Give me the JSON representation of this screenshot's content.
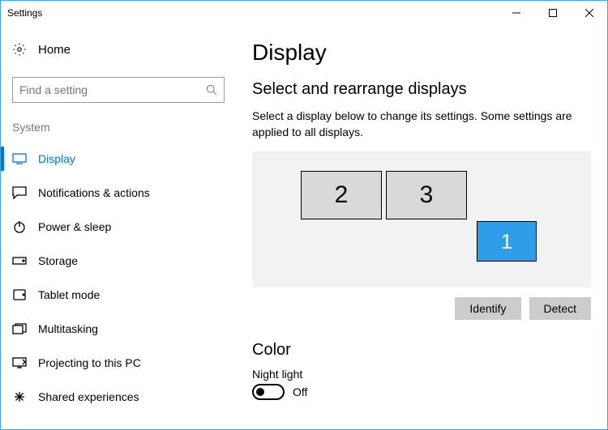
{
  "window": {
    "title": "Settings"
  },
  "home": {
    "label": "Home"
  },
  "search": {
    "placeholder": "Find a setting"
  },
  "section": "System",
  "nav": {
    "display": "Display",
    "notifications": "Notifications & actions",
    "power": "Power & sleep",
    "storage": "Storage",
    "tablet": "Tablet mode",
    "multitasking": "Multitasking",
    "projecting": "Projecting to this PC",
    "shared": "Shared experiences"
  },
  "page": {
    "title": "Display",
    "arrange_heading": "Select and rearrange displays",
    "arrange_desc": "Select a display below to change its settings. Some settings are applied to all displays.",
    "monitors": {
      "m1": "1",
      "m2": "2",
      "m3": "3"
    },
    "identify": "Identify",
    "detect": "Detect",
    "color_heading": "Color",
    "night_light_label": "Night light",
    "night_light_state": "Off"
  }
}
